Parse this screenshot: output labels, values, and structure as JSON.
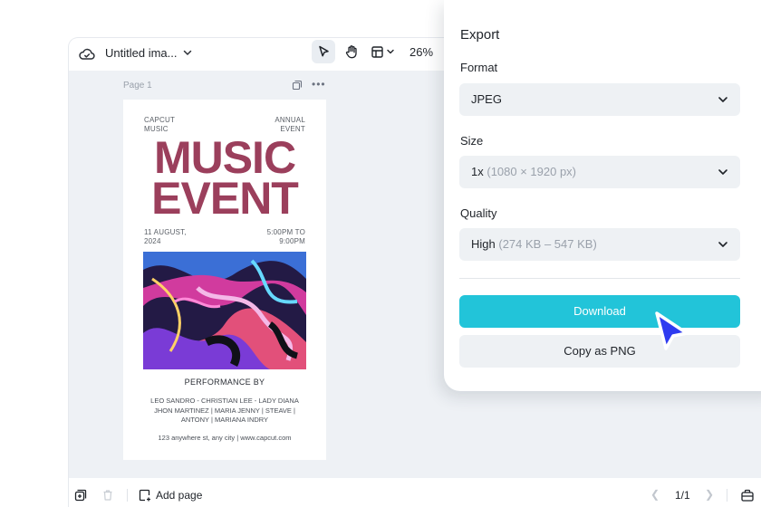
{
  "editor": {
    "doc_title": "Untitled ima...",
    "zoom": "26%",
    "page_label": "Page 1"
  },
  "poster": {
    "brand_line1": "CAPCUT",
    "brand_line2": "MUSIC",
    "tag_line1": "ANNUAL",
    "tag_line2": "EVENT",
    "title_line1": "MUSIC",
    "title_line2": "EVENT",
    "date_line1": "11 AUGUST,",
    "date_line2": "2024",
    "time_line1": "5:00PM TO",
    "time_line2": "9:00PM",
    "performance_heading": "PERFORMANCE BY",
    "performers_line1": "LEO SANDRO - CHRISTIAN LEE - LADY DIANA",
    "performers_line2": "JHON MARTINEZ | MARIA JENNY | STEAVE |",
    "performers_line3": "ANTONY | MARIANA INDRY",
    "footer": "123 anywhere st, any city | www.capcut.com",
    "title_color": "#9b3f5c"
  },
  "bottom_bar": {
    "add_page_label": "Add page",
    "page_counter": "1/1"
  },
  "export_panel": {
    "title": "Export",
    "format_label": "Format",
    "format_value": "JPEG",
    "size_label": "Size",
    "size_value": "1x",
    "size_detail": "(1080 × 1920 px)",
    "quality_label": "Quality",
    "quality_value": "High",
    "quality_detail": "(274 KB – 547 KB)",
    "download_label": "Download",
    "copy_label": "Copy as PNG",
    "accent_color": "#22c4d9"
  },
  "icons": {
    "cloud": "cloud-icon",
    "select": "pointer-icon",
    "hand": "hand-icon",
    "layout": "layout-icon",
    "chevron": "chevron-down-icon",
    "cursor": "cursor-arrow-icon"
  }
}
